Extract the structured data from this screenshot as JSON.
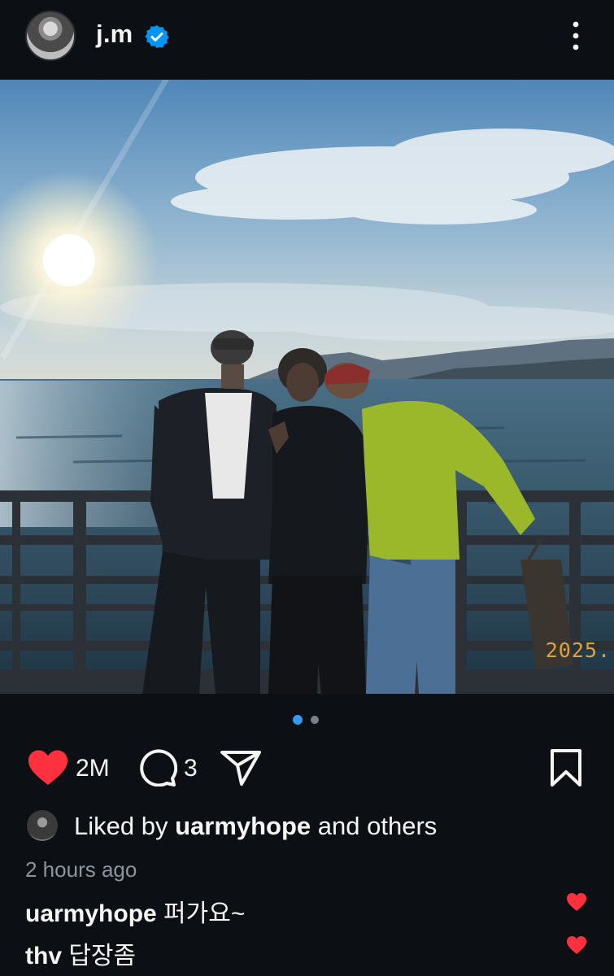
{
  "header": {
    "username": "j.m",
    "verified": true,
    "avatar_icon": "profile-avatar",
    "more_icon": "more-vertical-icon"
  },
  "post": {
    "photo_date_stamp": "2025.",
    "carousel": {
      "total": 2,
      "active": 1
    },
    "likes_count": "2M",
    "comments_count": "3",
    "liked_state": true,
    "liked_by": {
      "prefix": "Liked by ",
      "user": "uarmyhope",
      "suffix": " and others"
    },
    "timestamp": "2 hours ago",
    "comments": [
      {
        "user": "uarmyhope",
        "text": " 퍼가요~"
      },
      {
        "user": "thv",
        "text": " 답장좀"
      }
    ]
  },
  "colors": {
    "background": "#0c1014",
    "like_red": "#ff3040",
    "verified_blue": "#0095f6",
    "carousel_active": "#3897f0",
    "date_stamp": "#e1a23a"
  }
}
